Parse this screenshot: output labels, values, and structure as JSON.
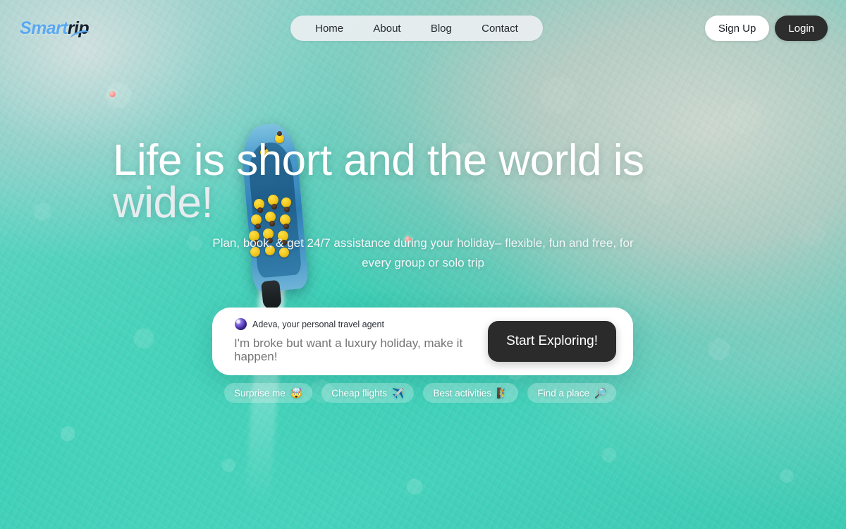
{
  "brand": {
    "name_primary": "Smart",
    "name_secondary": "rip",
    "logo_full": "SmarTrip",
    "accent_color": "#5aa8f2",
    "dark_color": "#13202c"
  },
  "nav": {
    "items": [
      {
        "label": "Home"
      },
      {
        "label": "About"
      },
      {
        "label": "Blog"
      },
      {
        "label": "Contact"
      }
    ]
  },
  "auth": {
    "signup_label": "Sign Up",
    "login_label": "Login",
    "login_bg": "#2d2d2d"
  },
  "hero": {
    "headline_line1": "Life is short and the world is",
    "headline_line2": "wide!",
    "subhead": "Plan, book, & get 24/7 assistance during your holiday– flexible, fun and free, for every group or solo trip"
  },
  "search": {
    "agent_label": "Adeva, your personal travel agent",
    "agent_icon": "orb-avatar-icon",
    "placeholder": "I'm broke but want a luxury holiday, make it happen!",
    "value": "",
    "cta_label": "Start Exploring!",
    "cta_bg": "#2b2b2b"
  },
  "chips": [
    {
      "label": "Surprise me",
      "emoji": "🤯",
      "icon": "exploding-head-icon"
    },
    {
      "label": "Cheap flights",
      "emoji": "✈️",
      "icon": "airplane-icon"
    },
    {
      "label": "Best activities",
      "emoji": "🧗",
      "icon": "climbing-icon"
    },
    {
      "label": "Find a place",
      "emoji": "🔎",
      "icon": "magnifier-icon"
    }
  ]
}
